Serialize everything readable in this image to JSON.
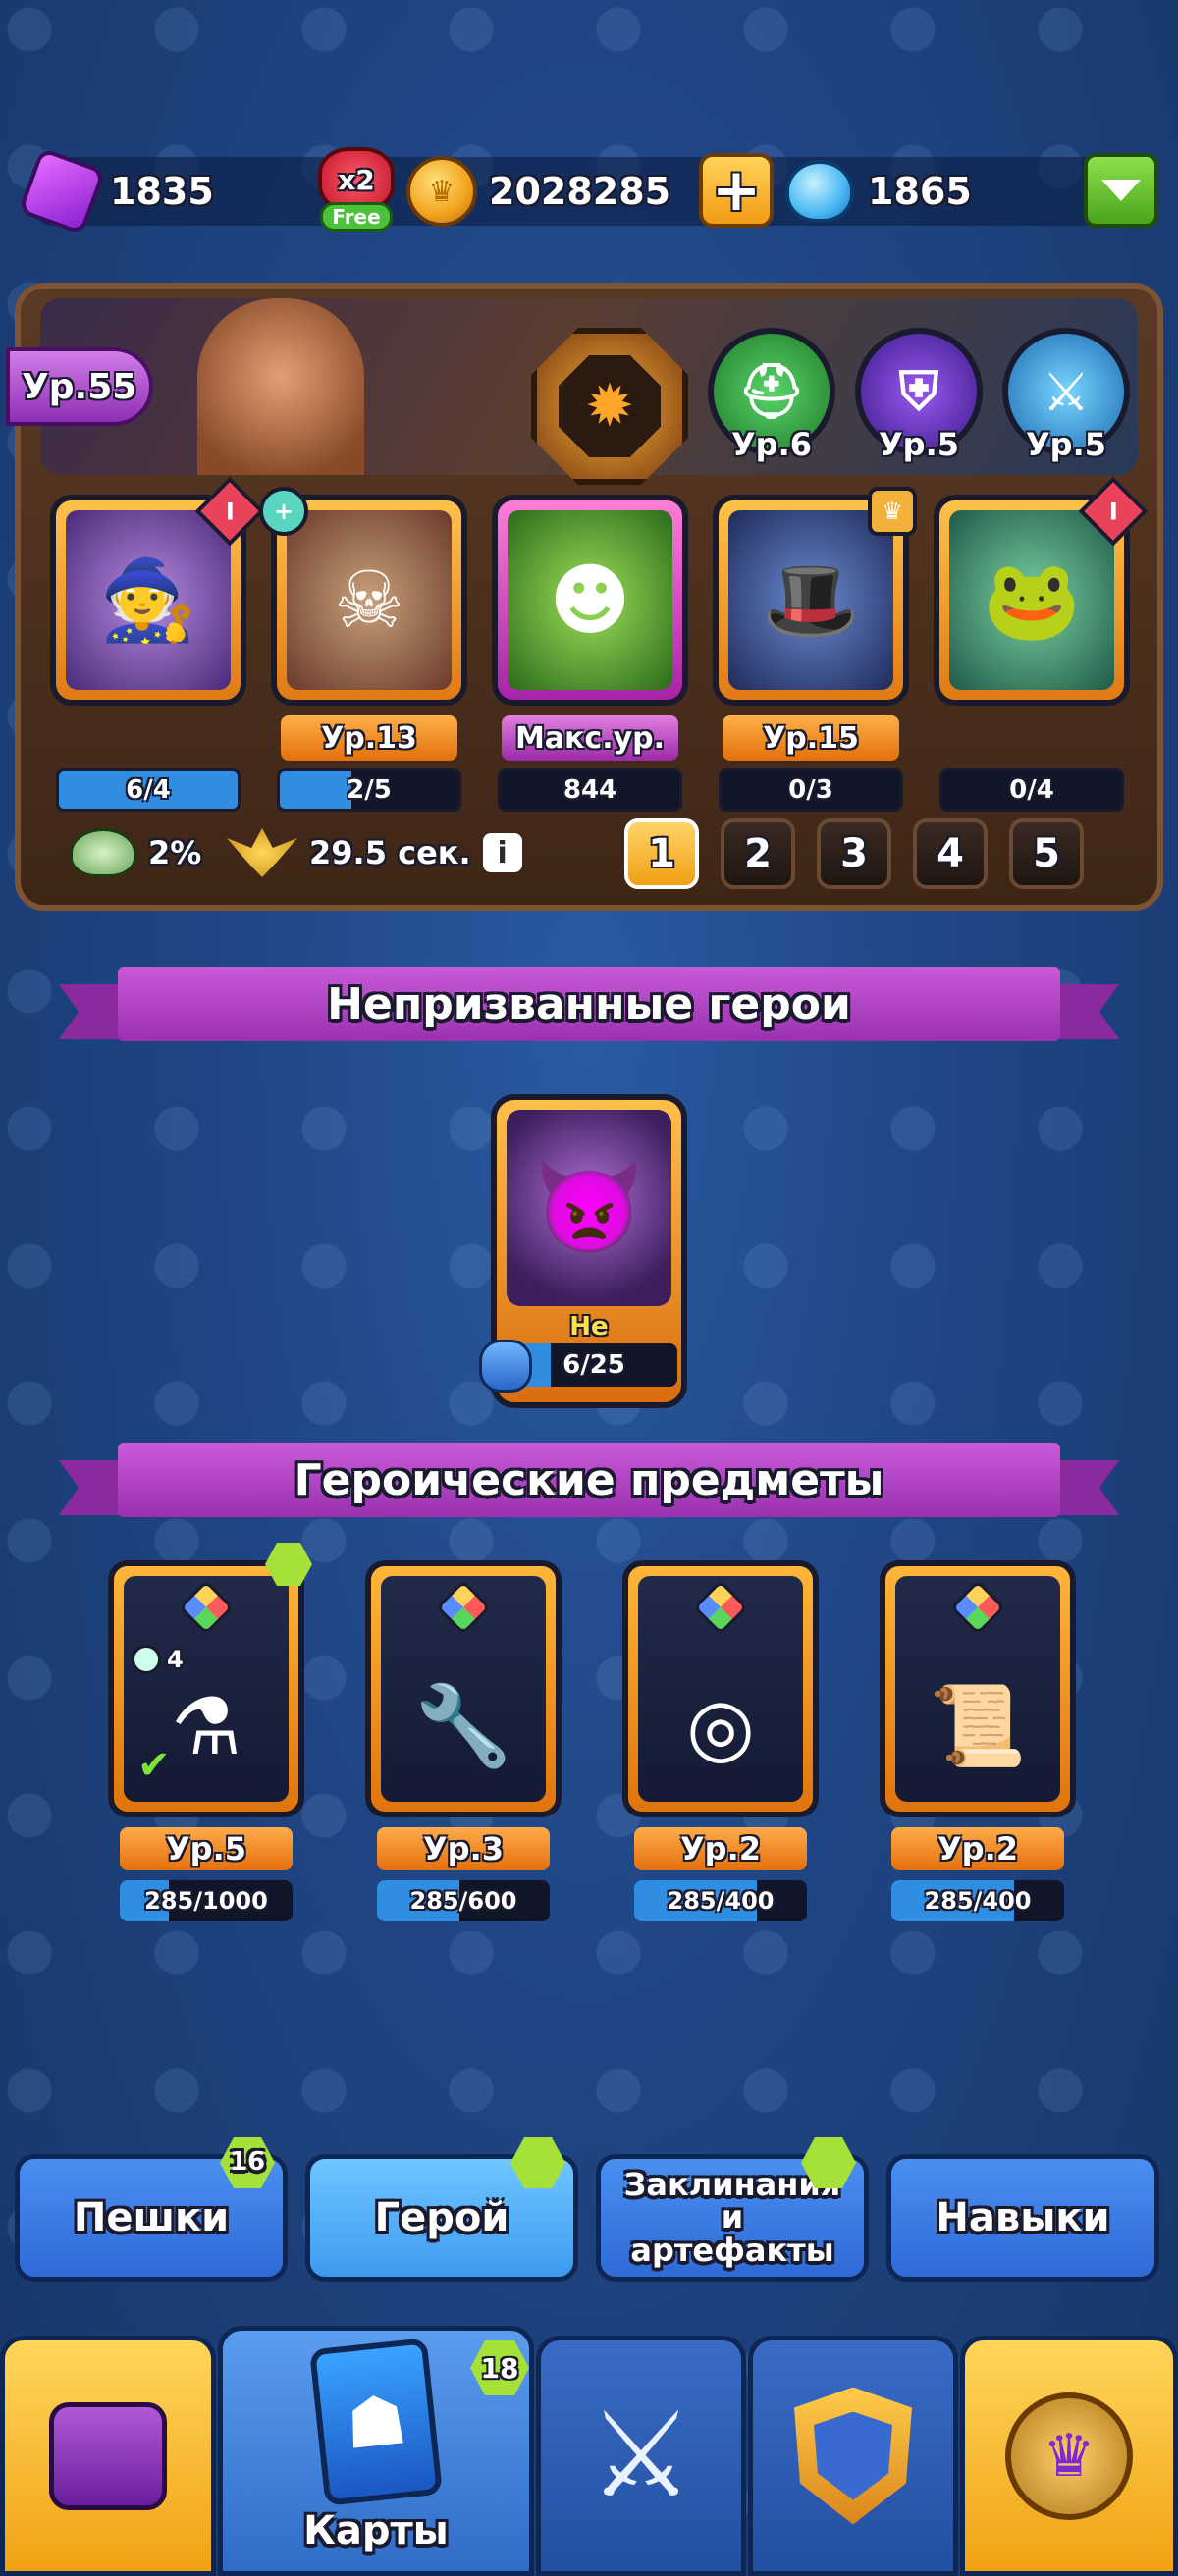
{
  "resources": {
    "gems": "1835",
    "coins": "2028285",
    "drops": "1865",
    "boost_multiplier": "x2",
    "boost_tag": "Free"
  },
  "hero": {
    "level": "Ур.55",
    "skills": [
      {
        "level": "Ур.6",
        "icon": "goblin-helmet-icon",
        "color": "#3bb85a"
      },
      {
        "level": "Ур.5",
        "icon": "shield-icon",
        "color": "#7a3ad6"
      },
      {
        "level": "Ур.5",
        "icon": "sword-icon",
        "color": "#3ab0e8"
      }
    ],
    "cards": [
      {
        "label": "",
        "progress_text": "6/4",
        "progress": 1.0,
        "badge": "I",
        "label_style": "none",
        "icon": "witch-icon"
      },
      {
        "label": "Ур.13",
        "progress_text": "2/5",
        "progress": 0.4,
        "badge": "potion",
        "label_style": "orange",
        "icon": "pirate-icon"
      },
      {
        "label": "Макс.ур.",
        "progress_text": "844",
        "progress": 0.0,
        "badge": "",
        "label_style": "pink",
        "icon": "totem-icon"
      },
      {
        "label": "Ур.15",
        "progress_text": "0/3",
        "progress": 0.0,
        "badge": "crown",
        "label_style": "orange",
        "icon": "bandit-icon"
      },
      {
        "label": "",
        "progress_text": "0/4",
        "progress": 0.0,
        "badge": "I",
        "label_style": "none",
        "icon": "frog-icon"
      }
    ],
    "bonus_percent": "2%",
    "timer": "29.5 сек.",
    "pages": [
      "1",
      "2",
      "3",
      "4",
      "5"
    ],
    "active_page": "1"
  },
  "sections": {
    "unsummoned_title": "Непризванные герои",
    "items_title": "Героические предметы"
  },
  "unsummoned": {
    "name": "Не призван",
    "progress_text": "6/25",
    "progress": 0.24
  },
  "items": [
    {
      "level": "Ур.5",
      "progress_text": "285/1000",
      "progress": 0.285,
      "count": "4",
      "icon": "potion-icon"
    },
    {
      "level": "Ур.3",
      "progress_text": "285/600",
      "progress": 0.475,
      "icon": "wrench-icon"
    },
    {
      "level": "Ур.2",
      "progress_text": "285/400",
      "progress": 0.71,
      "icon": "ring-icon"
    },
    {
      "level": "Ур.2",
      "progress_text": "285/400",
      "progress": 0.71,
      "icon": "scroll-icon"
    }
  ],
  "tabs": [
    {
      "label": "Пешки",
      "badge": "16"
    },
    {
      "label": "Герой",
      "badge": ""
    },
    {
      "label": "Заклинания и артефакты",
      "badge": ""
    },
    {
      "label": "Навыки",
      "badge": ""
    }
  ],
  "bottom_nav": {
    "cards_label": "Карты",
    "cards_badge": "18"
  }
}
